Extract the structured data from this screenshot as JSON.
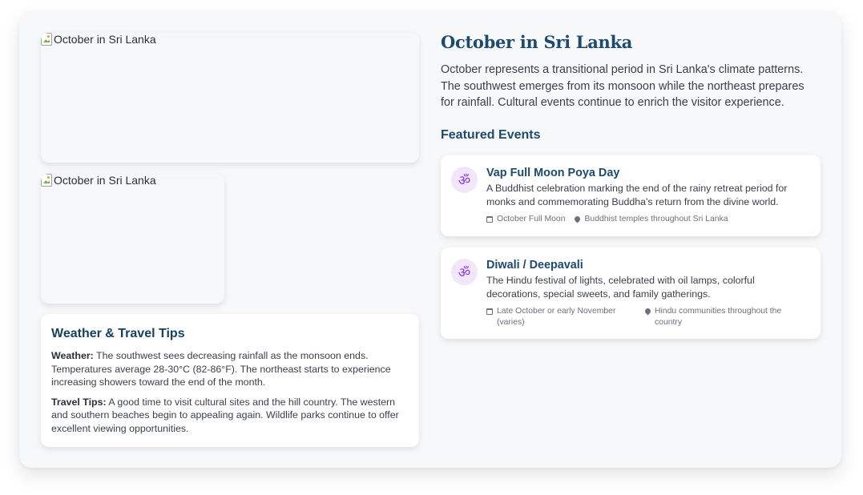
{
  "images": [
    {
      "alt": "October in Sri Lanka"
    },
    {
      "alt": "October in Sri Lanka"
    }
  ],
  "tips": {
    "title": "Weather & Travel Tips",
    "weather_label": "Weather:",
    "weather_text": " The southwest sees decreasing rainfall as the monsoon ends. Temperatures average 28-30°C (82-86°F). The northeast starts to experience increasing showers toward the end of the month.",
    "travel_label": "Travel Tips:",
    "travel_text": " A good time to visit cultural sites and the hill country. The western and southern beaches begin to appealing again. Wildlife parks continue to offer excellent viewing opportunities."
  },
  "main": {
    "title": "October in Sri Lanka",
    "intro": "October represents a transitional period in Sri Lanka's climate patterns. The southwest emerges from its monsoon while the northeast prepares for rainfall. Cultural events continue to enrich the visitor experience.",
    "section_title": "Featured Events"
  },
  "events": [
    {
      "icon": "om-icon",
      "glyph": "ॐ",
      "title": "Vap Full Moon Poya Day",
      "description": "A Buddhist celebration marking the end of the rainy retreat period for monks and commemorating Buddha's return from the divine world.",
      "date": "October Full Moon",
      "location": "Buddhist temples throughout Sri Lanka"
    },
    {
      "icon": "om-icon",
      "glyph": "ॐ",
      "title": "Diwali / Deepavali",
      "description": "The Hindu festival of lights, celebrated with oil lamps, colorful decorations, special sweets, and family gatherings.",
      "date": "Late October or early November (varies)",
      "location": "Hindu communities throughout the country"
    }
  ],
  "colors": {
    "heading": "#1d4a6d",
    "icon_bg": "#f1e6fb",
    "icon_fg": "#8e3fd6",
    "card_bg": "#f7f8fa"
  }
}
